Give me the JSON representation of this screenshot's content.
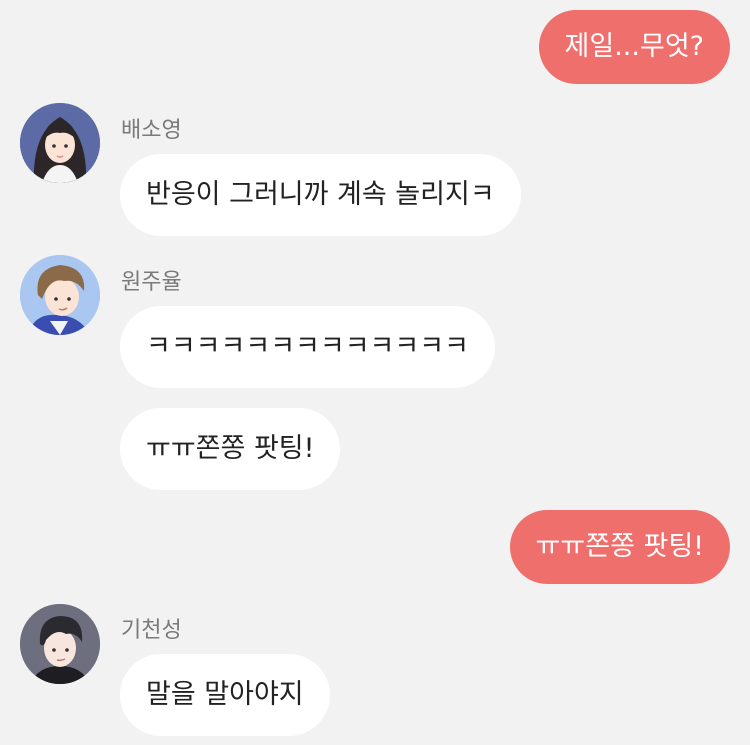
{
  "colors": {
    "background": "#f2f2f2",
    "outgoing_bubble": "#ef6f6c",
    "incoming_bubble": "#ffffff",
    "sender_name": "#7a7a7a"
  },
  "messages": [
    {
      "direction": "outgoing",
      "text": "제일...무엇?"
    },
    {
      "direction": "incoming",
      "sender": "배소영",
      "avatar": "girl-portrait-avatar",
      "text": "반응이 그러니까 계속 놀리지ㅋ"
    },
    {
      "direction": "incoming",
      "sender": "원주율",
      "avatar": "boy-portrait-avatar",
      "text": "ㅋㅋㅋㅋㅋㅋㅋㅋㅋㅋㅋㅋㅋ"
    },
    {
      "direction": "incoming",
      "sender": "원주율",
      "avatar": "",
      "text": "ㅠㅠ쫀쫑 팟팅!"
    },
    {
      "direction": "outgoing",
      "text": "ㅠㅠ쫀쫑 팟팅!"
    },
    {
      "direction": "incoming",
      "sender": "기천성",
      "avatar": "dark-hair-boy-avatar",
      "text": "말을 말아야지"
    }
  ]
}
